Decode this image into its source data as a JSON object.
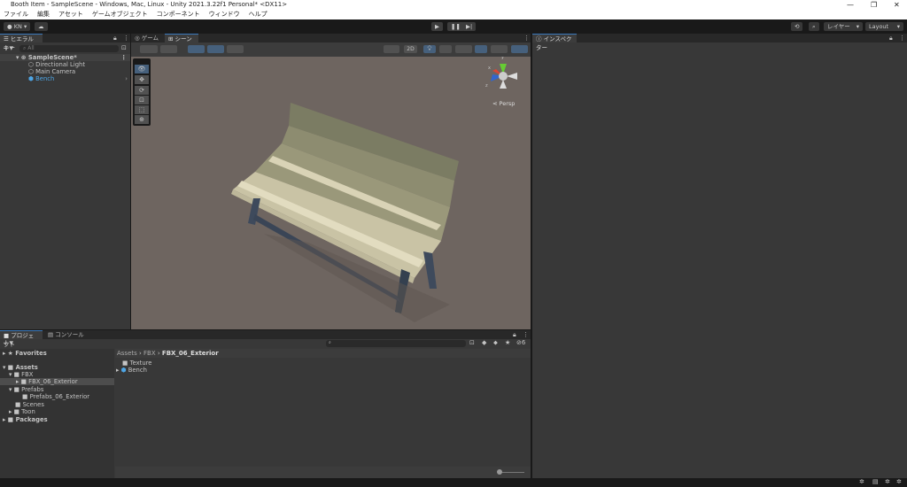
{
  "window": {
    "title": "Booth Item - SampleScene - Windows, Mac, Linux - Unity 2021.3.22f1 Personal* <DX11>"
  },
  "menu": [
    "ファイル",
    "編集",
    "アセット",
    "ゲームオブジェクト",
    "コンポーネント",
    "ウィンドウ",
    "ヘルプ"
  ],
  "toolbar": {
    "account": "KN ▾",
    "layers": "レイヤー",
    "layout": "Layout"
  },
  "hierarchy": {
    "tab": "ヒエラルキー",
    "search_placeholder": "All",
    "scene": "SampleScene*",
    "items": [
      "Directional Light",
      "Main Camera",
      "Bench"
    ]
  },
  "scene_view": {
    "tabs": [
      "ゲーム",
      "シーン"
    ],
    "mode_2d": "2D",
    "persp": "Persp",
    "gizmo_y": "y",
    "gizmo_x": "x",
    "gizmo_z": "z"
  },
  "inspector": {
    "tab": "インスペクター"
  },
  "project": {
    "tabs": [
      "プロジェクト",
      "コンソール"
    ],
    "tree": [
      {
        "label": "Favorites",
        "bold": true
      },
      {
        "label": "Assets",
        "bold": true
      },
      {
        "label": "FBX"
      },
      {
        "label": "FBX_06_Exterior"
      },
      {
        "label": "Prefabs"
      },
      {
        "label": "Prefabs_06_Exterior"
      },
      {
        "label": "Scenes"
      },
      {
        "label": "Toon"
      },
      {
        "label": "Packages",
        "bold": true
      }
    ],
    "breadcrumb": [
      "Assets",
      "FBX",
      "FBX_06_Exterior"
    ],
    "files": [
      "Texture",
      "Bench"
    ],
    "hidden_count": "6"
  },
  "colors": {
    "accent": "#3a79bb",
    "selected": "#2c5d87",
    "bench_link": "#4ea6e6"
  }
}
